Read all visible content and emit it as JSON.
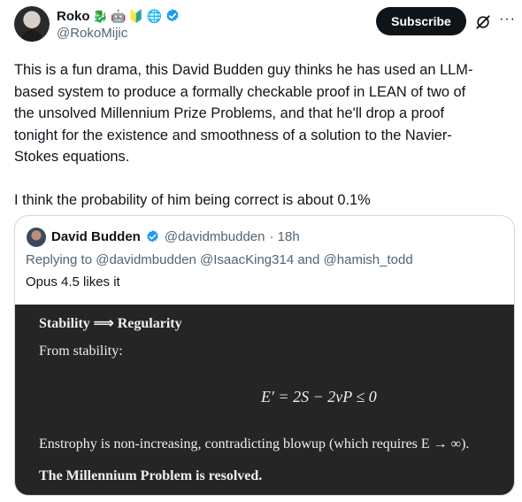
{
  "author": {
    "display_name": "Roko",
    "handle": "@RokoMijic",
    "badges": [
      "🐉",
      "🤖",
      "🔰",
      "🌐"
    ],
    "verified": true
  },
  "actions": {
    "subscribe_label": "Subscribe",
    "grok_icon": "grok-icon",
    "more_icon": "more-icon",
    "more_glyph": "···"
  },
  "tweet": {
    "text": "This is a fun drama, this David Budden guy thinks he has used an LLM-\nbased system to produce a formally checkable proof in LEAN of two of\nthe unsolved Millennium Prize Problems, and that he'll drop a proof\ntonight for the existence and smoothness of a solution to the Navier-\nStokes equations.\n\nI think the probability of him being correct is about 0.1%"
  },
  "quote": {
    "display_name": "David Budden",
    "handle": "@davidmbudden",
    "time": "· 18h",
    "replying_to_prefix": "Replying to",
    "mentions": [
      "@davidmbudden",
      "@IsaacKing314",
      "@hamish_todd"
    ],
    "and_word": "and",
    "body": "Opus 4.5 likes it",
    "image": {
      "title": "Stability ⟹ Regularity",
      "from": "From stability:",
      "equation": "E′ = 2S − 2νP ≤ 0",
      "enstrophy": "Enstrophy is non-increasing, contradicting blowup (which requires E → ∞).",
      "resolved": "The Millennium Problem is resolved."
    }
  },
  "colors": {
    "verified_blue": "#1d9bf0",
    "secondary_text": "#536471",
    "panel_bg": "#252525"
  }
}
